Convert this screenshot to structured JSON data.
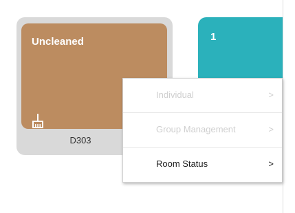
{
  "room_card": {
    "status_label": "Uncleaned",
    "room_number": "D303",
    "status_icon": "broom-icon",
    "card_color": "#bc8c60"
  },
  "second_card": {
    "count": "1",
    "card_color": "#2bb1bb"
  },
  "context_menu": {
    "items": [
      {
        "label": "Individual",
        "arrow": ">",
        "enabled": false
      },
      {
        "label": "Group Management",
        "arrow": ">",
        "enabled": false
      },
      {
        "label": "Room Status",
        "arrow": ">",
        "enabled": true
      }
    ]
  }
}
